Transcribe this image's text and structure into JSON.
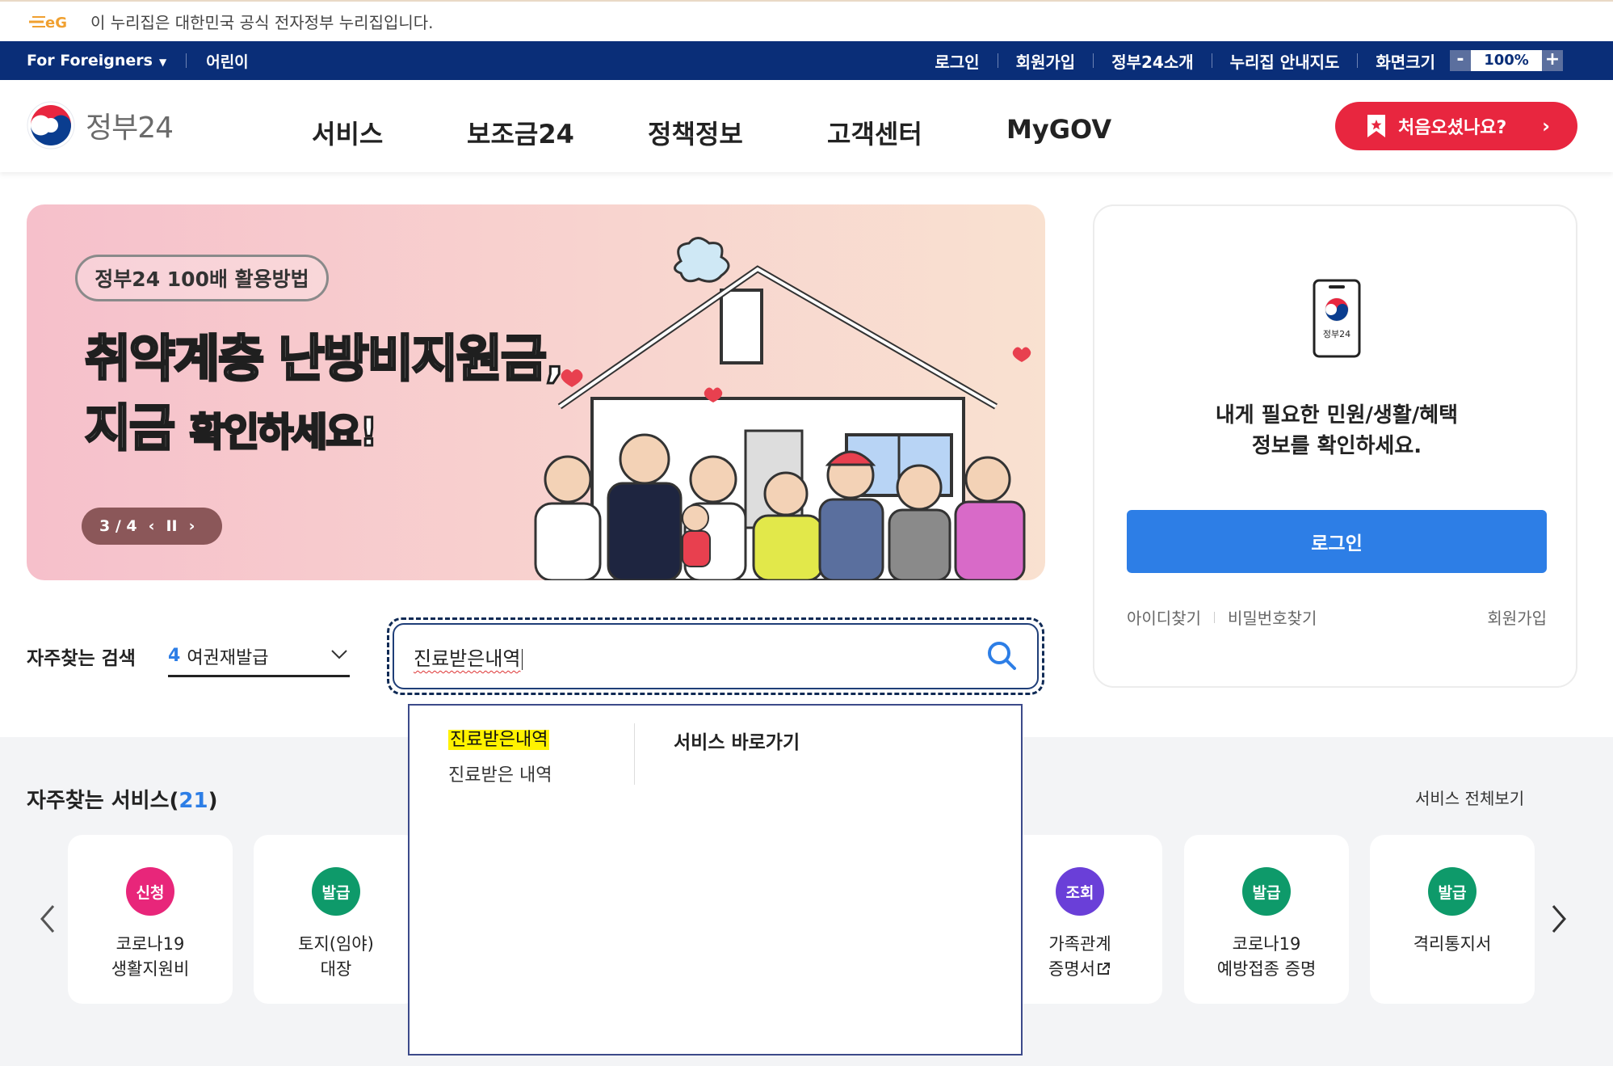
{
  "gov_banner": {
    "text": "이 누리집은 대한민국 공식 전자정부 누리집입니다."
  },
  "util_bar": {
    "left": [
      {
        "label": "For Foreigners"
      },
      {
        "label": "어린이"
      }
    ],
    "right": [
      {
        "label": "로그인"
      },
      {
        "label": "회원가입"
      },
      {
        "label": "정부24소개"
      },
      {
        "label": "누리집 안내지도"
      },
      {
        "label": "화면크기"
      }
    ],
    "zoom": {
      "minus": "-",
      "value": "100%",
      "plus": "+"
    }
  },
  "header": {
    "logo_text": "정부24",
    "nav": [
      {
        "label": "서비스"
      },
      {
        "label": "보조금24"
      },
      {
        "label": "정책정보"
      },
      {
        "label": "고객센터"
      },
      {
        "label": "MyGOV"
      }
    ],
    "first_visit": "처음오셨나요?",
    "first_visit_arrow": "›"
  },
  "hero": {
    "pill": "정부24 100배 활용방법",
    "line1": "취약계층 난방비지원금,",
    "line2_big": "지금",
    "line2_small": "확인하세요!",
    "counter": "3 / 4",
    "prev": "‹",
    "pause": "II",
    "next": "›"
  },
  "login_box": {
    "phone_label": "정부24",
    "message_line1": "내게 필요한 민원/생활/혜택",
    "message_line2": "정보를 확인하세요.",
    "login_button": "로그인",
    "find_id": "아이디찾기",
    "find_pw": "비밀번호찾기",
    "join": "회원가입"
  },
  "search": {
    "freq_label": "자주찾는 검색",
    "freq_num": "4",
    "freq_value": "여권재발급",
    "query": "진료받은내역"
  },
  "autocomplete": {
    "highlight": "진료받은내역",
    "suggestion": "진료받은 내역",
    "shortcut_title": "서비스 바로가기"
  },
  "services": {
    "title": "자주찾는 서비스(",
    "count": "21",
    "title_end": ")",
    "view_all": "서비스 전체보기",
    "cards": [
      {
        "badge": "신청",
        "color": "#e8267a",
        "line1": "코로나19",
        "line2": "생활지원비"
      },
      {
        "badge": "발급",
        "color": "#0e9a6a",
        "line1": "토지(임야)",
        "line2": "대장"
      },
      {
        "badge": "조회",
        "color": "#6a3fd8",
        "line1": "가족관계",
        "line2": "증명서"
      },
      {
        "badge": "발급",
        "color": "#0e9a6a",
        "line1": "코로나19",
        "line2": "예방접종 증명"
      },
      {
        "badge": "발급",
        "color": "#0e9a6a",
        "line1": "격리통지서",
        "line2": ""
      }
    ]
  },
  "colors": {
    "util_bg": "#0a2e78",
    "accent_red": "#e8263f",
    "accent_blue": "#2d7ee6"
  }
}
